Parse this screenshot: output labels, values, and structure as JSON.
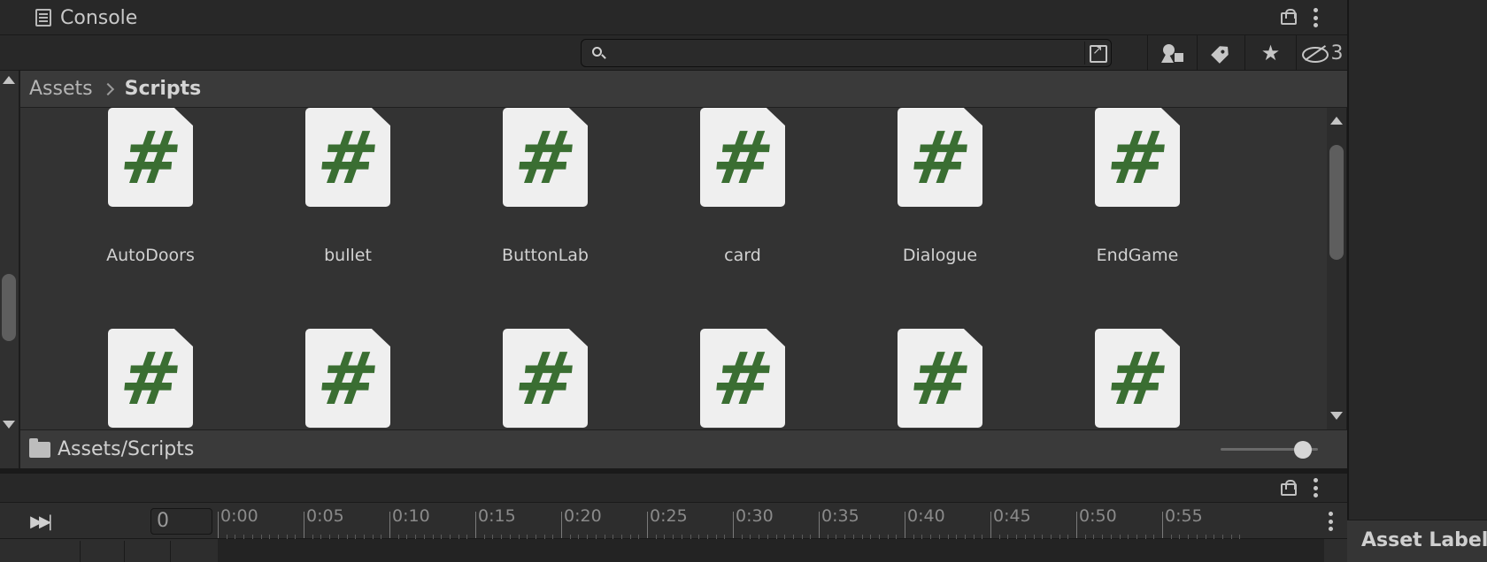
{
  "console": {
    "title": "Console"
  },
  "toolbar": {
    "search": {
      "value": "",
      "placeholder": ""
    },
    "hidden_packages_count": "3"
  },
  "breadcrumb": {
    "root": "Assets",
    "current": "Scripts"
  },
  "assets": [
    {
      "label": "AutoDoors",
      "icon": "csharp-script-icon",
      "glyph": "#"
    },
    {
      "label": "bullet",
      "icon": "csharp-script-icon",
      "glyph": "#"
    },
    {
      "label": "ButtonLab",
      "icon": "csharp-script-icon",
      "glyph": "#"
    },
    {
      "label": "card",
      "icon": "csharp-script-icon",
      "glyph": "#"
    },
    {
      "label": "Dialogue",
      "icon": "csharp-script-icon",
      "glyph": "#"
    },
    {
      "label": "EndGame",
      "icon": "csharp-script-icon",
      "glyph": "#"
    },
    {
      "label": "",
      "icon": "csharp-script-icon",
      "glyph": "#"
    },
    {
      "label": "",
      "icon": "csharp-script-icon",
      "glyph": "#"
    },
    {
      "label": "",
      "icon": "csharp-script-icon",
      "glyph": "#"
    },
    {
      "label": "",
      "icon": "csharp-script-icon",
      "glyph": "#"
    },
    {
      "label": "",
      "icon": "csharp-script-icon",
      "glyph": "#"
    },
    {
      "label": "",
      "icon": "csharp-script-icon",
      "glyph": "#"
    }
  ],
  "status_bar": {
    "path": "Assets/Scripts",
    "zoom_level": 0.92
  },
  "timeline": {
    "frame_value": "0",
    "ruler_labels": [
      "0:00",
      "0:05",
      "0:10",
      "0:15",
      "0:20",
      "0:25",
      "0:30",
      "0:35",
      "0:40",
      "0:45",
      "0:50",
      "0:55"
    ]
  },
  "inspector": {
    "asset_labels_title": "Asset Label"
  },
  "colors": {
    "background": "#333333",
    "script_icon_glyph": "#3a6e32",
    "script_icon_page": "#efefef"
  }
}
